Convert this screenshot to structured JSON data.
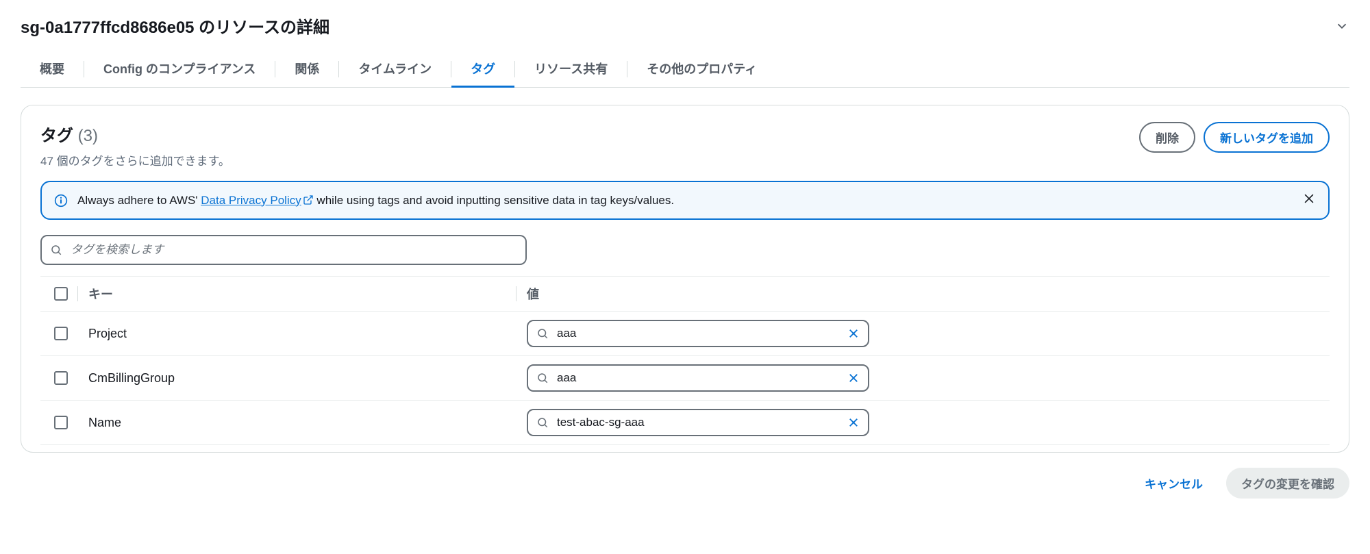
{
  "header": {
    "title": "sg-0a1777ffcd8686e05 のリソースの詳細"
  },
  "tabs": {
    "overview": "概要",
    "compliance": "Config のコンプライアンス",
    "relationships": "関係",
    "timeline": "タイムライン",
    "tags": "タグ",
    "resource_sharing": "リソース共有",
    "other_properties": "その他のプロパティ"
  },
  "panel": {
    "title": "タグ",
    "count": "(3)",
    "subtitle": "47 個のタグをさらに追加できます。",
    "delete_label": "削除",
    "add_label": "新しいタグを追加"
  },
  "alert": {
    "prefix": "Always adhere to AWS' ",
    "link": "Data Privacy Policy",
    "suffix": " while using tags and avoid inputting sensitive data in tag keys/values."
  },
  "search": {
    "placeholder": "タグを検索します"
  },
  "table": {
    "header_key": "キー",
    "header_value": "値",
    "rows": [
      {
        "key": "Project",
        "value": "aaa"
      },
      {
        "key": "CmBillingGroup",
        "value": "aaa"
      },
      {
        "key": "Name",
        "value": "test-abac-sg-aaa"
      }
    ]
  },
  "footer": {
    "cancel": "キャンセル",
    "confirm": "タグの変更を確認"
  }
}
